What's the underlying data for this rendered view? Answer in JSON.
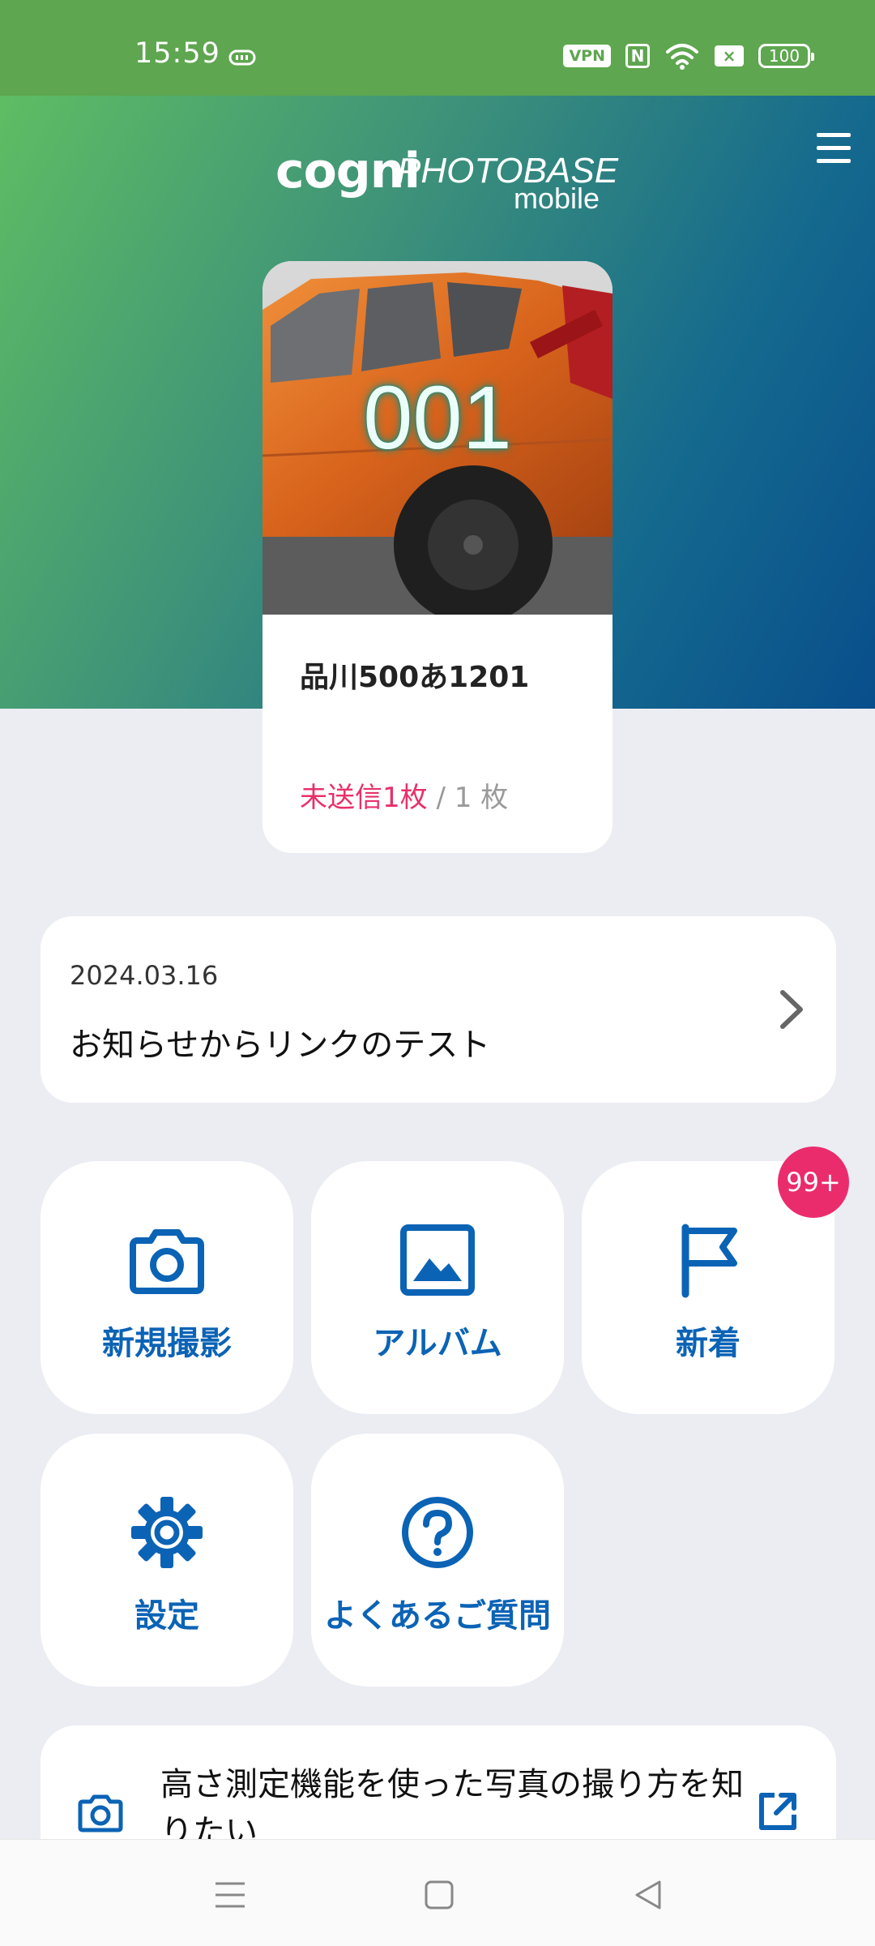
{
  "status_bar": {
    "time": "15:59",
    "vpn_label": "VPN",
    "nfc_label": "N",
    "sim_label": "×",
    "battery": "100"
  },
  "header": {
    "logo_cogni": "cogni",
    "logo_photobase": "PHOTOBASE",
    "logo_mobile": "mobile",
    "menu_icon": "hamburger-icon"
  },
  "vehicle_card": {
    "number": "001",
    "plate": "品川500あ1201",
    "unsent": "未送信1枚",
    "separator": "/",
    "total": "1 枚"
  },
  "notice": {
    "date": "2024.03.16",
    "title": "お知らせからリンクのテスト"
  },
  "tiles": [
    {
      "label": "新規撮影",
      "icon": "camera-icon"
    },
    {
      "label": "アルバム",
      "icon": "image-icon"
    },
    {
      "label": "新着",
      "icon": "flag-icon"
    },
    {
      "label": "設定",
      "icon": "gear-icon"
    },
    {
      "label": "よくあるご質問",
      "icon": "question-icon"
    }
  ],
  "badge": "99+",
  "howto": {
    "text": "高さ測定機能を使った写真の撮り方を知りたい",
    "icon": "camera-icon",
    "link_icon": "external-link-icon"
  },
  "colors": {
    "accent_blue": "#0b63b5",
    "badge_pink": "#ea2c6d",
    "status_green": "#5ea64f"
  }
}
